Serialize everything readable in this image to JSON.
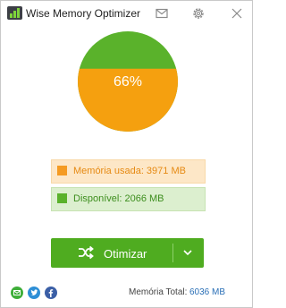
{
  "window": {
    "title": "Wise Memory Optimizer"
  },
  "memory": {
    "used_percent": 66,
    "used_percent_text": "66%",
    "used_label": "Memória usada: 3971 MB",
    "free_label": "Disponível: 2066 MB",
    "total_label": "Memória Total:",
    "total_value": "6036 MB"
  },
  "actions": {
    "optimize_label": "Otimizar"
  },
  "icons": {
    "app": "memory-chip-icon",
    "titlebar": [
      "mail-icon",
      "gear-icon",
      "close-icon"
    ],
    "optimize": "shuffle-icon",
    "dropdown": "chevron-down-icon",
    "social": [
      "email-icon",
      "twitter-icon",
      "facebook-icon"
    ]
  },
  "colors": {
    "used": "#f5a00f",
    "free": "#5ab22b",
    "button": "#4fac20",
    "total_value": "#2a6fb6"
  }
}
